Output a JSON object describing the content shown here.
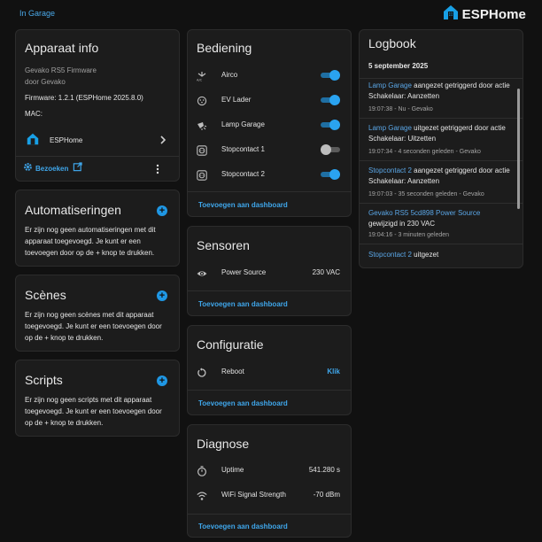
{
  "header": {
    "breadcrumb": "In Garage",
    "brand": "ESPHome"
  },
  "device_info": {
    "title": "Apparaat info",
    "firmware_name": "Gevako RS5 Firmware",
    "manufacturer": "door Gevako",
    "firmware_label": "Firmware: 1.2.1 (ESPHome 2025.8.0)",
    "mac_label": "MAC:",
    "integration": "ESPHome",
    "visit_label": "Bezoeken"
  },
  "automations": {
    "title": "Automatiseringen",
    "text": "Er zijn nog geen automatiseringen met dit apparaat toegevoegd. Je kunt er een toevoegen door op de + knop te drukken."
  },
  "scenes": {
    "title": "Scènes",
    "text": "Er zijn nog geen scènes met dit apparaat toegevoegd. Je kunt er een toevoegen door op de + knop te drukken."
  },
  "scripts": {
    "title": "Scripts",
    "text": "Er zijn nog geen scripts met dit apparaat toegevoegd. Je kunt er een toevoegen door op de + knop te drukken."
  },
  "controls": {
    "title": "Bediening",
    "items": [
      {
        "label": "Airco",
        "icon": "airco-icon",
        "state": "on"
      },
      {
        "label": "EV Lader",
        "icon": "ev-charger-icon",
        "state": "on"
      },
      {
        "label": "Lamp Garage",
        "icon": "lamp-icon",
        "state": "on"
      },
      {
        "label": "Stopcontact 1",
        "icon": "socket-icon",
        "state": "off"
      },
      {
        "label": "Stopcontact 2",
        "icon": "socket-icon",
        "state": "on"
      }
    ],
    "add_label": "Toevoegen aan dashboard"
  },
  "sensors": {
    "title": "Sensoren",
    "items": [
      {
        "label": "Power Source",
        "value": "230 VAC",
        "icon": "eye-icon"
      }
    ],
    "add_label": "Toevoegen aan dashboard"
  },
  "configuration": {
    "title": "Configuratie",
    "items": [
      {
        "label": "Reboot",
        "action": "Klik",
        "icon": "restart-icon"
      }
    ],
    "add_label": "Toevoegen aan dashboard"
  },
  "diagnostics": {
    "title": "Diagnose",
    "items": [
      {
        "label": "Uptime",
        "value": "541.280 s",
        "icon": "timer-icon"
      },
      {
        "label": "WiFi Signal Strength",
        "value": "-70 dBm",
        "icon": "wifi-icon"
      }
    ],
    "add_label": "Toevoegen aan dashboard"
  },
  "logbook": {
    "title": "Logbook",
    "date": "5 september 2025",
    "entries": [
      {
        "entity": "Lamp Garage",
        "text": "aangezet getriggerd door actie Schakelaar: Aanzetten",
        "meta": "19:07:38 - Nu - Gevako"
      },
      {
        "entity": "Lamp Garage",
        "text": "uitgezet getriggerd door actie Schakelaar: Uitzetten",
        "meta": "19:07:34 - 4 seconden geleden - Gevako"
      },
      {
        "entity": "Stopcontact 2",
        "text": "aangezet getriggerd door actie Schakelaar: Aanzetten",
        "meta": "19:07:03 - 35 seconden geleden - Gevako"
      },
      {
        "entity": "Gevako RS5 5cd898 Power Source",
        "text": "gewijzigd in 230 VAC",
        "meta": "19:04:16 - 3 minuten geleden"
      },
      {
        "entity": "Stopcontact 2",
        "text": "uitgezet",
        "meta": ""
      }
    ]
  },
  "colors": {
    "accent": "#1f97e4",
    "background": "#111111",
    "card": "#1c1c1c"
  }
}
